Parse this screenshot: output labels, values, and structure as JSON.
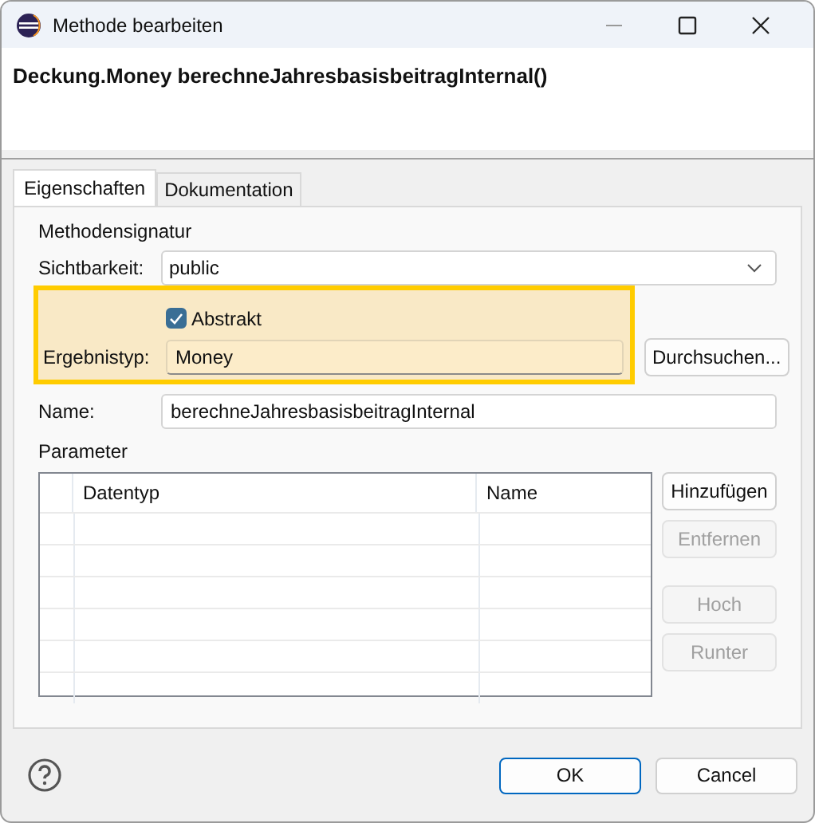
{
  "window": {
    "title": "Methode bearbeiten"
  },
  "header": {
    "title": "Deckung.Money berechneJahresbasisbeitragInternal()"
  },
  "tabs": [
    {
      "label": "Eigenschaften",
      "selected": true
    },
    {
      "label": "Dokumentation",
      "selected": false
    }
  ],
  "signature": {
    "group_label": "Methodensignatur",
    "visibility_label": "Sichtbarkeit:",
    "visibility_value": "public",
    "abstract": {
      "label": "Abstrakt",
      "checked": true
    },
    "highlighted": true,
    "return_type_label": "Ergebnistyp:",
    "return_type_value": "Money",
    "browse_button": "Durchsuchen...",
    "name_label": "Name:",
    "name_value": "berechneJahresbasisbeitragInternal"
  },
  "parameters": {
    "label": "Parameter",
    "columns": [
      "Datentyp",
      "Name"
    ],
    "buttons": [
      {
        "label": "Hinzufügen",
        "disabled": false
      },
      {
        "label": "Entfernen",
        "disabled": true
      },
      {
        "label": "Hoch",
        "disabled": true
      },
      {
        "label": "Runter",
        "disabled": true
      }
    ]
  },
  "footer": {
    "buttons": [
      {
        "label": "OK",
        "default": true
      },
      {
        "label": "Cancel",
        "default": false
      }
    ]
  }
}
